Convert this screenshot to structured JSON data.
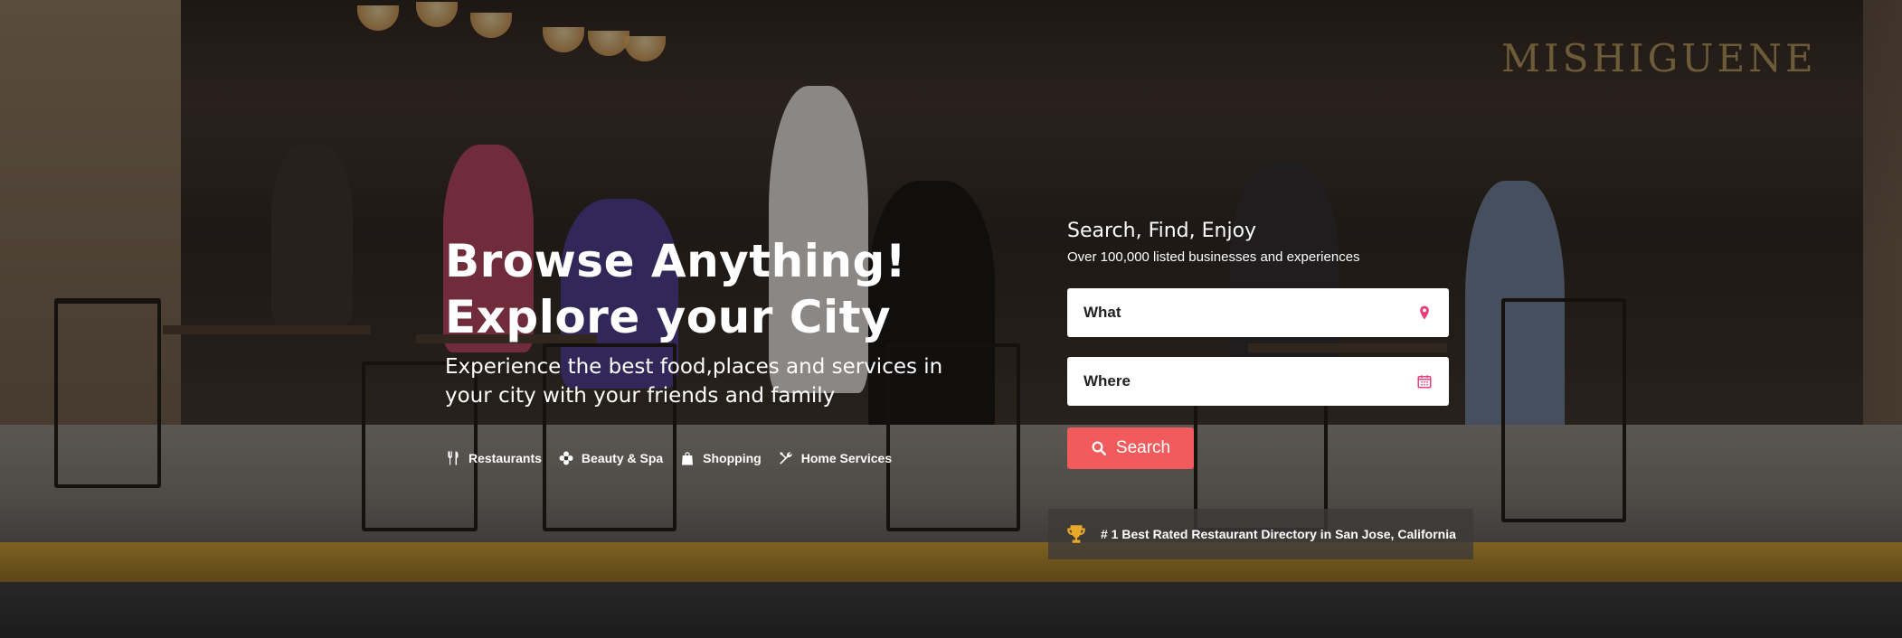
{
  "hero": {
    "headline_line1": "Browse Anything!",
    "headline_line2": "Explore your City",
    "subline": "Experience the best food,places and services in your city with your friends and family",
    "storefront_sign": "MISHIGUENE"
  },
  "categories": [
    {
      "label": "Restaurants",
      "icon": "fork-knife-icon"
    },
    {
      "label": "Beauty & Spa",
      "icon": "flower-icon"
    },
    {
      "label": "Shopping",
      "icon": "shopping-bag-icon"
    },
    {
      "label": "Home Services",
      "icon": "tools-icon"
    }
  ],
  "search": {
    "title": "Search, Find, Enjoy",
    "subtitle": "Over 100,000 listed businesses and experiences",
    "what_label": "What",
    "where_label": "Where",
    "button_label": "Search",
    "accent_color": "#f15b5b",
    "icon_color": "#e8417a"
  },
  "award": {
    "text": "# 1 Best Rated Restaurant Directory in San Jose, California",
    "icon": "trophy-icon",
    "icon_color": "#e9a928"
  }
}
